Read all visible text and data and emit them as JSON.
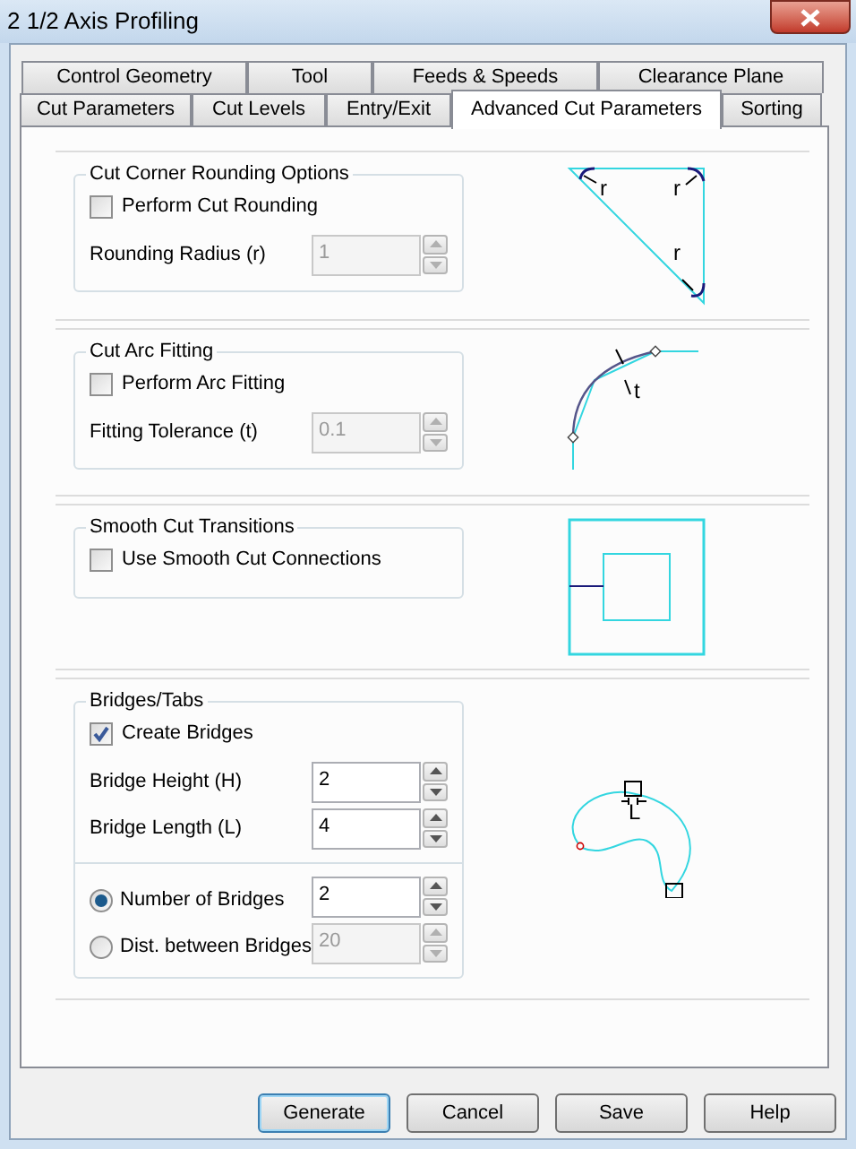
{
  "window": {
    "title": "2 1/2 Axis Profiling"
  },
  "tab_rows": [
    {
      "tabs": [
        {
          "label": "Control Geometry",
          "selected": false
        },
        {
          "label": "Tool",
          "selected": false
        },
        {
          "label": "Feeds & Speeds",
          "selected": false
        },
        {
          "label": "Clearance Plane",
          "selected": false
        }
      ]
    },
    {
      "tabs": [
        {
          "label": "Cut Parameters",
          "selected": false
        },
        {
          "label": "Cut Levels",
          "selected": false
        },
        {
          "label": "Entry/Exit",
          "selected": false
        },
        {
          "label": "Advanced Cut Parameters",
          "selected": true
        },
        {
          "label": "Sorting",
          "selected": false
        }
      ]
    }
  ],
  "sections": [
    {
      "title": "Cut Corner Rounding Options",
      "diagram": {
        "kind": "corner",
        "labels": [
          "r",
          "r",
          "r"
        ]
      },
      "items": [
        {
          "kind": "checkbox",
          "label": "Perform Cut Rounding",
          "checked": false
        },
        {
          "kind": "spin",
          "label": "Rounding Radius (r)",
          "value": "1",
          "disabled": true
        }
      ]
    },
    {
      "title": "Cut Arc Fitting",
      "diagram": {
        "kind": "arc",
        "labels": [
          "t"
        ]
      },
      "items": [
        {
          "kind": "checkbox",
          "label": "Perform Arc Fitting",
          "checked": false
        },
        {
          "kind": "spin",
          "label": "Fitting Tolerance (t)",
          "value": "0.1",
          "disabled": true
        }
      ]
    },
    {
      "title": "Smooth Cut Transitions",
      "diagram": {
        "kind": "smooth",
        "labels": []
      },
      "items": [
        {
          "kind": "checkbox",
          "label": "Use Smooth Cut Connections",
          "checked": false
        }
      ]
    },
    {
      "title": "Bridges/Tabs",
      "diagram": {
        "kind": "bridges",
        "labels": [
          "L"
        ]
      },
      "items": [
        {
          "kind": "checkbox",
          "label": "Create Bridges",
          "checked": true
        },
        {
          "kind": "spin",
          "label": "Bridge Height (H)",
          "value": "2",
          "disabled": false
        },
        {
          "kind": "spin",
          "label": "Bridge Length (L)",
          "value": "4",
          "disabled": false
        },
        {
          "kind": "radios",
          "options": [
            {
              "label": "Number of Bridges",
              "selected": true,
              "value": "2",
              "disabled": false
            },
            {
              "label": "Dist. between Bridges",
              "selected": false,
              "value": "20",
              "disabled": true
            }
          ]
        }
      ]
    }
  ],
  "buttons": [
    {
      "label": "Generate",
      "default": true
    },
    {
      "label": "Cancel",
      "default": false
    },
    {
      "label": "Save",
      "default": false
    },
    {
      "label": "Help",
      "default": false
    }
  ]
}
